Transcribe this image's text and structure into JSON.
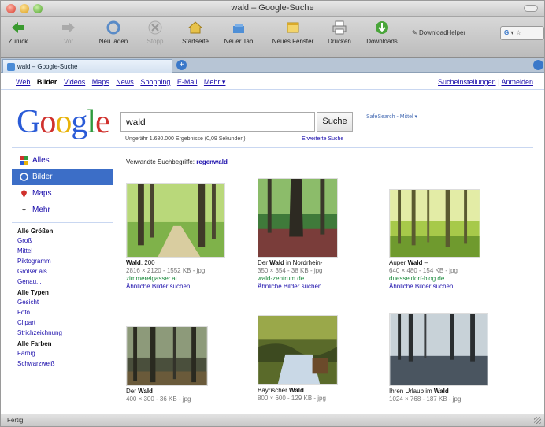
{
  "window": {
    "title": "wald – Google-Suche"
  },
  "toolbar": {
    "buttons": [
      {
        "label": "Zurück",
        "icon": "back-arrow-icon"
      },
      {
        "label": "Vor",
        "icon": "forward-arrow-icon"
      },
      {
        "label": "Neu laden",
        "icon": "reload-icon"
      },
      {
        "label": "Stopp",
        "icon": "stop-icon"
      },
      {
        "label": "Startseite",
        "icon": "home-icon"
      },
      {
        "label": "Neuer Tab",
        "icon": "new-tab-icon"
      },
      {
        "label": "Neues Fenster",
        "icon": "new-window-icon"
      },
      {
        "label": "Drucken",
        "icon": "print-icon"
      },
      {
        "label": "Downloads",
        "icon": "downloads-icon"
      }
    ],
    "downloadhelper": "DownloadHelper"
  },
  "tabbar": {
    "tab_title": "wald – Google-Suche",
    "new_tab": "+"
  },
  "gnav": {
    "links": [
      "Web",
      "Bilder",
      "Videos",
      "Maps",
      "News",
      "Shopping",
      "E-Mail",
      "Mehr ▾"
    ],
    "current": "Bilder",
    "settings": "Sucheinstellungen",
    "separator": "|",
    "signin": "Anmelden"
  },
  "logo": {
    "g1": "G",
    "o1": "o",
    "o2": "o",
    "g2": "g",
    "l": "l",
    "e": "e"
  },
  "search": {
    "query": "wald",
    "button": "Suche",
    "safesearch": "SafeSearch - Mittel ▾",
    "stats": "Ungefähr 1.680.000 Ergebnisse (0,09 Sekunden)",
    "advanced": "Erweiterte Suche"
  },
  "sidebar": {
    "modes": [
      {
        "label": "Alles",
        "icon": "all-results-icon"
      },
      {
        "label": "Bilder",
        "icon": "images-icon"
      },
      {
        "label": "Maps",
        "icon": "map-pin-icon"
      },
      {
        "label": "Mehr",
        "icon": "more-icon"
      }
    ],
    "sizes_head": "Alle Größen",
    "sizes": [
      "Groß",
      "Mittel",
      "Piktogramm",
      "Größer als...",
      "Genau..."
    ],
    "types_head": "Alle Typen",
    "types": [
      "Gesicht",
      "Foto",
      "Clipart",
      "Strichzeichnung"
    ],
    "colors_head": "Alle Farben",
    "colors": [
      "Farbig",
      "Schwarzweiß"
    ]
  },
  "related": {
    "label": "Verwandte Suchbegriffe:",
    "term": "regenwald"
  },
  "results": [
    {
      "title": "Wald, 200",
      "meta": "2816 × 2120 - 1552 KB - jpg",
      "site": "zimmereigasser.at",
      "similar": "Ähnliche Bilder suchen"
    },
    {
      "title": "Der Wald in Nordrhein-",
      "meta": "350 × 354 - 38 KB - jpg",
      "site": "wald-zentrum.de",
      "similar": "Ähnliche Bilder suchen"
    },
    {
      "title": "Auper Wald –",
      "meta": "640 × 480 - 154 KB - jpg",
      "site": "duesseldorf-blog.de",
      "similar": "Ähnliche Bilder suchen"
    },
    {
      "title": "Der Wald",
      "meta": "400 × 300 - 36 KB - jpg",
      "site": "",
      "similar": ""
    },
    {
      "title": "Bayrischer Wald",
      "meta": "800 × 600 - 129 KB - jpg",
      "site": "",
      "similar": ""
    },
    {
      "title": "Ihren Urlaub im Wald",
      "meta": "1024 × 768 - 187 KB - jpg",
      "site": "",
      "similar": ""
    }
  ],
  "statusbar": {
    "text": "Fertig"
  }
}
